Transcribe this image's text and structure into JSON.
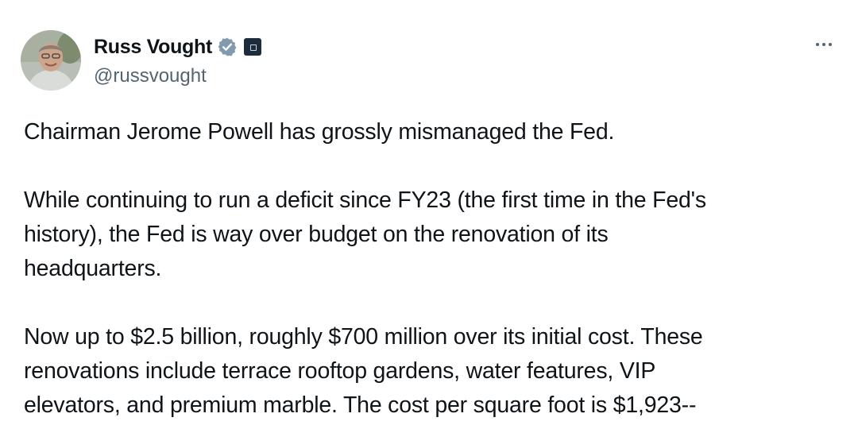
{
  "author": {
    "display_name": "Russ Vought",
    "handle": "@russvought",
    "verified_icon": "verified-badge-icon",
    "affiliation_icon": "affiliation-badge-icon",
    "avatar": "avatar-photo"
  },
  "menu": {
    "icon": "more-options-icon"
  },
  "tweet": {
    "paragraphs": [
      "Chairman Jerome Powell has grossly mismanaged the Fed.",
      "While continuing to run a deficit since FY23 (the first time in the Fed's\nhistory), the Fed is way over budget on the renovation of its\nheadquarters.",
      "Now up to $2.5 billion, roughly $700 million over its initial cost. These\nrenovations include terrace rooftop gardens, water features, VIP\nelevators, and premium marble. The cost per square foot is $1,923--"
    ]
  },
  "colors": {
    "text": "#0f1419",
    "secondary_text": "#536471",
    "verified_badge": "#829aab",
    "affiliate_badge": "#1d2c3d"
  }
}
